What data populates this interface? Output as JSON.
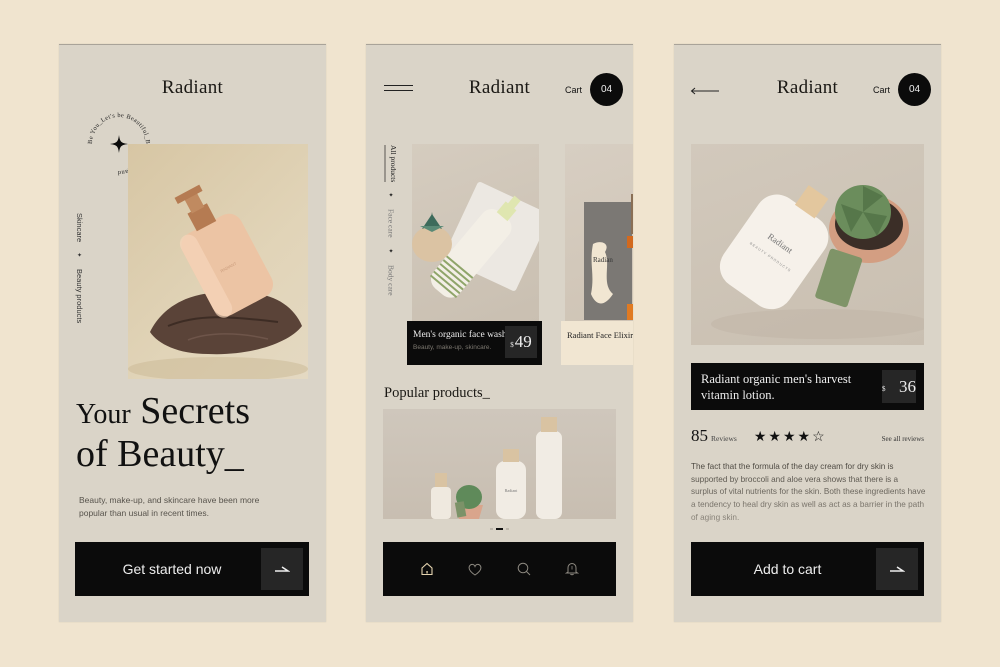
{
  "brand": "Radiant",
  "colors": {
    "page_bg": "#f0e4cf",
    "panel_bg": "#dad4c8",
    "dark": "#0b0b0b",
    "dark_accent": "#262626",
    "nav_active": "#e5d4b0"
  },
  "screen_home": {
    "brand": "Radiant",
    "badge_text": "Be You_Let's be Beautiful_Be Colorful_and ",
    "badge_icon": "sparkle-star-icon",
    "side_labels": [
      "Skincare",
      "Beauty products"
    ],
    "hero_image_alt": "Peach pump bottle on brown pillow",
    "headline_line1_small": "Your",
    "headline_line1_big": "Secrets",
    "headline_line2": "of Beauty_",
    "intro": "Beauty, make-up, and skincare have been more popular than usual in recent times.",
    "cta_label": "Get started now",
    "cta_icon": "arrow-right-icon"
  },
  "screen_catalog": {
    "brand": "Radiant",
    "menu_icon": "hamburger-menu-icon",
    "cart_label": "Cart",
    "cart_count": "04",
    "tabs": [
      {
        "label": "All products",
        "active": true
      },
      {
        "label": "Face care",
        "active": false
      },
      {
        "label": "Body care",
        "active": false
      }
    ],
    "products": [
      {
        "name": "Men's organic face wash",
        "tags": "Beauty, make-up, skincare.",
        "currency": "$",
        "price": "49"
      },
      {
        "name": "Radiant Face Elixir",
        "tags": "",
        "currency": "",
        "price": ""
      }
    ],
    "section_title": "Popular products_",
    "carousel": {
      "total": 3,
      "active_index": 1
    },
    "bottom_nav": [
      {
        "icon": "home-icon",
        "active": true
      },
      {
        "icon": "heart-icon",
        "active": false
      },
      {
        "icon": "search-icon",
        "active": false
      },
      {
        "icon": "bell-icon",
        "active": false
      }
    ]
  },
  "screen_detail": {
    "brand": "Radiant",
    "back_icon": "arrow-left-icon",
    "cart_label": "Cart",
    "cart_count": "04",
    "product_title": "Radiant organic men's harvest vitamin lotion.",
    "currency": "$",
    "price": "36",
    "reviews_count": "85",
    "reviews_word": "Reviews",
    "rating": 4,
    "rating_max": 5,
    "see_all_label": "See all reviews",
    "description": "The fact that the formula of the day cream for dry skin is supported by broccoli and aloe vera shows that there is a surplus of vital nutrients for the skin. Both these ingredients have a tendency to heal dry skin as well as act as a barrier in the path of aging skin.",
    "add_to_cart_label": "Add to cart",
    "add_icon": "arrow-right-icon"
  }
}
